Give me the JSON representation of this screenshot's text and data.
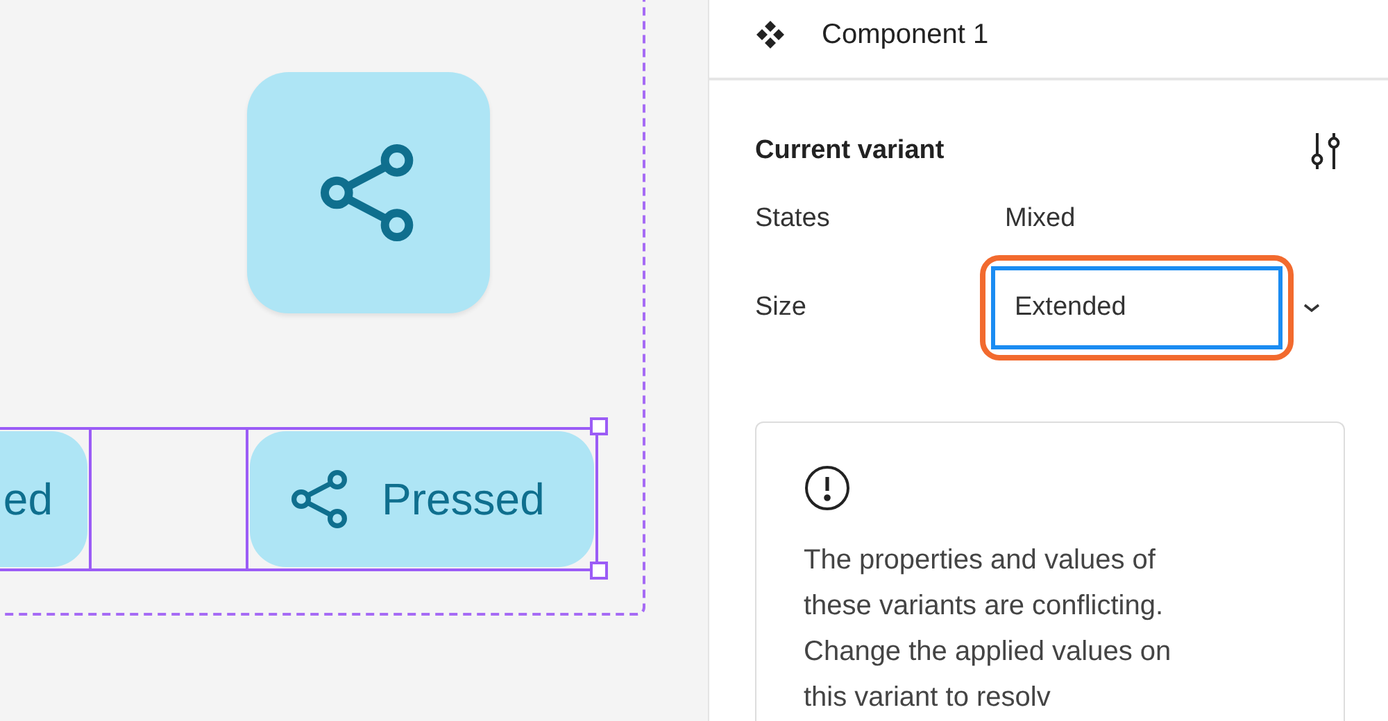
{
  "canvas": {
    "buttons": [
      {
        "label": "ed",
        "selected": true,
        "handles": false
      },
      {
        "label": "Pressed",
        "selected": true,
        "handles": true
      }
    ]
  },
  "panel": {
    "title": "Component 1",
    "section": {
      "title": "Current variant",
      "properties": [
        {
          "kind": "text",
          "label": "States",
          "value": "Mixed"
        },
        {
          "kind": "dropdown",
          "label": "Size",
          "value": "Extended",
          "focused": true,
          "highlighted": true
        }
      ]
    },
    "warning": {
      "text": "The properties and values of these variants are conflicting. Change the applied values on this variant to resolv"
    }
  }
}
